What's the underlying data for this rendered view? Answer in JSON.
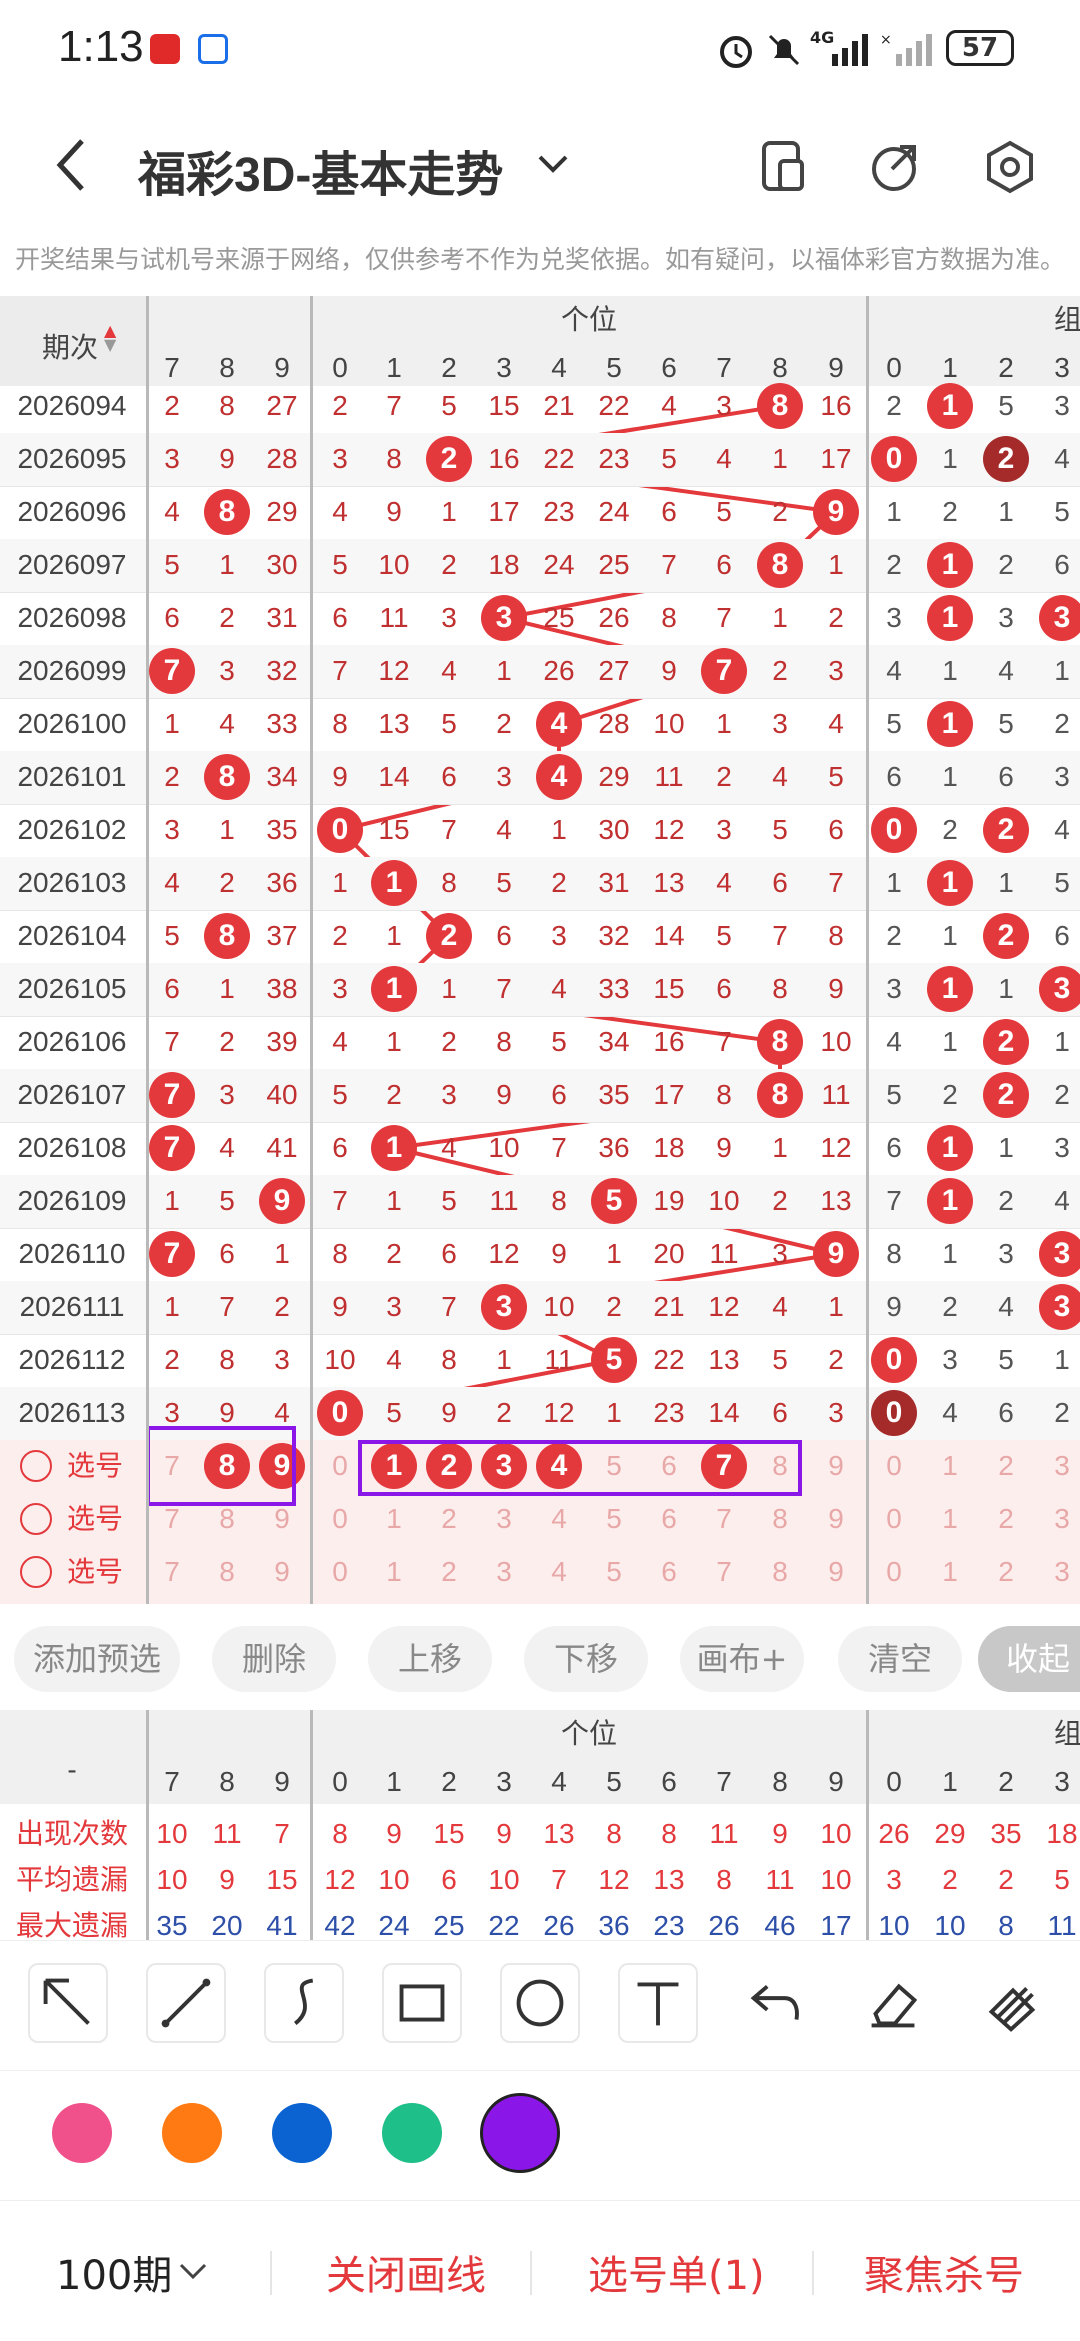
{
  "status_bar": {
    "time": "1:13",
    "battery": "57",
    "network": "4G"
  },
  "header": {
    "title": "福彩3D-基本走势"
  },
  "notice": "开奖结果与试机号来源于网络，仅供参考不作为兑奖依据。如有疑问，以福体彩官方数据为准。",
  "table": {
    "period_header": "期次",
    "group_header_ones": "个位",
    "group_header_combo": "组",
    "left_cols": [
      "7",
      "8",
      "9"
    ],
    "ones_cols": [
      "0",
      "1",
      "2",
      "3",
      "4",
      "5",
      "6",
      "7",
      "8",
      "9"
    ],
    "combo_cols": [
      "0",
      "1",
      "2",
      "3"
    ],
    "rows": [
      {
        "period": "2026094",
        "left": [
          "2",
          "8",
          "27"
        ],
        "ones": [
          "2",
          "7",
          "5",
          "15",
          "21",
          "22",
          "4",
          "3",
          "8",
          "16"
        ],
        "ones_hit": 8,
        "combo": [
          "2",
          "1",
          "5",
          "3"
        ],
        "combo_hit": [
          1
        ]
      },
      {
        "period": "2026095",
        "left": [
          "3",
          "9",
          "28"
        ],
        "ones": [
          "3",
          "8",
          "2",
          "16",
          "22",
          "23",
          "5",
          "4",
          "1",
          "17"
        ],
        "ones_hit": 2,
        "combo": [
          "0",
          "1",
          "2",
          "4"
        ],
        "combo_hit": [
          0,
          2
        ]
      },
      {
        "period": "2026096",
        "left": [
          "4",
          "8",
          "29"
        ],
        "left_hit": 1,
        "ones": [
          "4",
          "9",
          "1",
          "17",
          "23",
          "24",
          "6",
          "5",
          "2",
          "9"
        ],
        "ones_hit": 9,
        "combo": [
          "1",
          "2",
          "1",
          "5"
        ],
        "combo_hit": []
      },
      {
        "period": "2026097",
        "left": [
          "5",
          "1",
          "30"
        ],
        "ones": [
          "5",
          "10",
          "2",
          "18",
          "24",
          "25",
          "7",
          "6",
          "8",
          "1"
        ],
        "ones_hit": 8,
        "combo": [
          "2",
          "1",
          "2",
          "6"
        ],
        "combo_hit": [
          1
        ]
      },
      {
        "period": "2026098",
        "left": [
          "6",
          "2",
          "31"
        ],
        "ones": [
          "6",
          "11",
          "3",
          "3",
          "25",
          "26",
          "8",
          "7",
          "1",
          "2"
        ],
        "ones_hit": 3,
        "combo": [
          "3",
          "1",
          "3",
          "3"
        ],
        "combo_hit": [
          1,
          3
        ]
      },
      {
        "period": "2026099",
        "left": [
          "7",
          "3",
          "32"
        ],
        "left_hit": 0,
        "ones": [
          "7",
          "12",
          "4",
          "1",
          "26",
          "27",
          "9",
          "7",
          "2",
          "3"
        ],
        "ones_hit": 7,
        "combo": [
          "4",
          "1",
          "4",
          "1"
        ],
        "combo_hit": []
      },
      {
        "period": "2026100",
        "left": [
          "1",
          "4",
          "33"
        ],
        "ones": [
          "8",
          "13",
          "5",
          "2",
          "4",
          "28",
          "10",
          "1",
          "3",
          "4"
        ],
        "ones_hit": 4,
        "combo": [
          "5",
          "1",
          "5",
          "2"
        ],
        "combo_hit": [
          1
        ]
      },
      {
        "period": "2026101",
        "left": [
          "2",
          "8",
          "34"
        ],
        "left_hit": 1,
        "ones": [
          "9",
          "14",
          "6",
          "3",
          "4",
          "29",
          "11",
          "2",
          "4",
          "5"
        ],
        "ones_hit": 4,
        "combo": [
          "6",
          "1",
          "6",
          "3"
        ],
        "combo_hit": []
      },
      {
        "period": "2026102",
        "left": [
          "3",
          "1",
          "35"
        ],
        "ones": [
          "0",
          "15",
          "7",
          "4",
          "1",
          "30",
          "12",
          "3",
          "5",
          "6"
        ],
        "ones_hit": 0,
        "combo": [
          "0",
          "2",
          "2",
          "4"
        ],
        "combo_hit": [
          0,
          2
        ]
      },
      {
        "period": "2026103",
        "left": [
          "4",
          "2",
          "36"
        ],
        "ones": [
          "1",
          "1",
          "8",
          "5",
          "2",
          "31",
          "13",
          "4",
          "6",
          "7"
        ],
        "ones_hit": 1,
        "combo": [
          "1",
          "1",
          "1",
          "5"
        ],
        "combo_hit": [
          1
        ]
      },
      {
        "period": "2026104",
        "left": [
          "5",
          "8",
          "37"
        ],
        "left_hit": 1,
        "ones": [
          "2",
          "1",
          "2",
          "6",
          "3",
          "32",
          "14",
          "5",
          "7",
          "8"
        ],
        "ones_hit": 2,
        "combo": [
          "2",
          "1",
          "2",
          "6"
        ],
        "combo_hit": [
          2
        ]
      },
      {
        "period": "2026105",
        "left": [
          "6",
          "1",
          "38"
        ],
        "ones": [
          "3",
          "1",
          "1",
          "7",
          "4",
          "33",
          "15",
          "6",
          "8",
          "9"
        ],
        "ones_hit": 1,
        "combo": [
          "3",
          "1",
          "1",
          "3"
        ],
        "combo_hit": [
          1,
          3
        ]
      },
      {
        "period": "2026106",
        "left": [
          "7",
          "2",
          "39"
        ],
        "ones": [
          "4",
          "1",
          "2",
          "8",
          "5",
          "34",
          "16",
          "7",
          "8",
          "10"
        ],
        "ones_hit": 8,
        "combo": [
          "4",
          "1",
          "2",
          "1"
        ],
        "combo_hit": [
          2
        ]
      },
      {
        "period": "2026107",
        "left": [
          "7",
          "3",
          "40"
        ],
        "left_hit": 0,
        "ones": [
          "5",
          "2",
          "3",
          "9",
          "6",
          "35",
          "17",
          "8",
          "8",
          "11"
        ],
        "ones_hit": 8,
        "combo": [
          "5",
          "2",
          "2",
          "2"
        ],
        "combo_hit": [
          2
        ]
      },
      {
        "period": "2026108",
        "left": [
          "7",
          "4",
          "41"
        ],
        "left_hit": 0,
        "ones": [
          "6",
          "1",
          "4",
          "10",
          "7",
          "36",
          "18",
          "9",
          "1",
          "12"
        ],
        "ones_hit": 1,
        "combo": [
          "6",
          "1",
          "1",
          "3"
        ],
        "combo_hit": [
          1
        ]
      },
      {
        "period": "2026109",
        "left": [
          "1",
          "5",
          "9"
        ],
        "left_hit": 2,
        "ones": [
          "7",
          "1",
          "5",
          "11",
          "8",
          "5",
          "19",
          "10",
          "2",
          "13"
        ],
        "ones_hit": 5,
        "combo": [
          "7",
          "1",
          "2",
          "4"
        ],
        "combo_hit": [
          1
        ]
      },
      {
        "period": "2026110",
        "left": [
          "7",
          "6",
          "1"
        ],
        "left_hit": 0,
        "ones": [
          "8",
          "2",
          "6",
          "12",
          "9",
          "1",
          "20",
          "11",
          "3",
          "9"
        ],
        "ones_hit": 9,
        "combo": [
          "8",
          "1",
          "3",
          "3"
        ],
        "combo_hit": [
          3
        ]
      },
      {
        "period": "2026111",
        "left": [
          "1",
          "7",
          "2"
        ],
        "ones": [
          "9",
          "3",
          "7",
          "3",
          "10",
          "2",
          "21",
          "12",
          "4",
          "1"
        ],
        "ones_hit": 3,
        "combo": [
          "9",
          "2",
          "4",
          "3"
        ],
        "combo_hit": [
          3
        ]
      },
      {
        "period": "2026112",
        "left": [
          "2",
          "8",
          "3"
        ],
        "ones": [
          "10",
          "4",
          "8",
          "1",
          "11",
          "5",
          "22",
          "13",
          "5",
          "2"
        ],
        "ones_hit": 5,
        "combo": [
          "0",
          "3",
          "5",
          "1"
        ],
        "combo_hit": [
          0
        ]
      },
      {
        "period": "2026113",
        "left": [
          "3",
          "9",
          "4"
        ],
        "ones": [
          "0",
          "5",
          "9",
          "2",
          "12",
          "1",
          "23",
          "14",
          "6",
          "3"
        ],
        "ones_hit": 0,
        "combo": [
          "0",
          "4",
          "6",
          "2"
        ],
        "combo_hit": [
          0
        ],
        "combo_dark": [
          0
        ]
      }
    ],
    "pick_label": "选号",
    "pick_rows": [
      {
        "left": [
          "7",
          "8",
          "9"
        ],
        "left_sel": [
          1,
          2
        ],
        "ones": [
          "0",
          "1",
          "2",
          "3",
          "4",
          "5",
          "6",
          "7",
          "8",
          "9"
        ],
        "ones_sel": [
          1,
          2,
          3,
          4,
          7
        ],
        "combo": [
          "0",
          "1",
          "2",
          "3"
        ]
      },
      {
        "left": [
          "7",
          "8",
          "9"
        ],
        "left_sel": [],
        "ones": [
          "0",
          "1",
          "2",
          "3",
          "4",
          "5",
          "6",
          "7",
          "8",
          "9"
        ],
        "ones_sel": [],
        "combo": [
          "0",
          "1",
          "2",
          "3"
        ]
      },
      {
        "left": [
          "7",
          "8",
          "9"
        ],
        "left_sel": [],
        "ones": [
          "0",
          "1",
          "2",
          "3",
          "4",
          "5",
          "6",
          "7",
          "8",
          "9"
        ],
        "ones_sel": [],
        "combo": [
          "0",
          "1",
          "2",
          "3"
        ]
      }
    ]
  },
  "actions": [
    "添加预选",
    "删除",
    "上移",
    "下移",
    "画布+",
    "清空",
    "收起"
  ],
  "stats": {
    "dash": "-",
    "group_header_ones": "个位",
    "group_header_combo": "组",
    "rows": [
      {
        "label": "出现次数",
        "left": [
          "10",
          "11",
          "7"
        ],
        "ones": [
          "8",
          "9",
          "15",
          "9",
          "13",
          "8",
          "8",
          "11",
          "9",
          "10"
        ],
        "combo": [
          "26",
          "29",
          "35",
          "18"
        ]
      },
      {
        "label": "平均遗漏",
        "left": [
          "10",
          "9",
          "15"
        ],
        "ones": [
          "12",
          "10",
          "6",
          "10",
          "7",
          "12",
          "13",
          "8",
          "11",
          "10"
        ],
        "combo": [
          "3",
          "2",
          "2",
          "5"
        ]
      },
      {
        "label": "最大遗漏",
        "left": [
          "35",
          "20",
          "41"
        ],
        "ones": [
          "42",
          "24",
          "25",
          "22",
          "26",
          "36",
          "23",
          "26",
          "46",
          "17"
        ],
        "combo": [
          "10",
          "10",
          "8",
          "11"
        ]
      }
    ]
  },
  "tools": [
    "pointer-arrow-icon",
    "line-icon",
    "curve-icon",
    "rectangle-icon",
    "circle-icon",
    "text-icon",
    "undo-icon",
    "eraser-icon",
    "clear-brush-icon"
  ],
  "colors": [
    "#f0518a",
    "#ff7a12",
    "#0a63d1",
    "#1fbf8a",
    "#8b16e8"
  ],
  "bottom": {
    "periods": "100期",
    "close_lines": "关闭画线",
    "pick_list": "选号单(1)",
    "focus": "聚焦杀号"
  },
  "theme": {
    "red": "#e4393c",
    "dark_red": "#a52a2a",
    "purple": "#8b16e8",
    "line": "#e4393c"
  }
}
